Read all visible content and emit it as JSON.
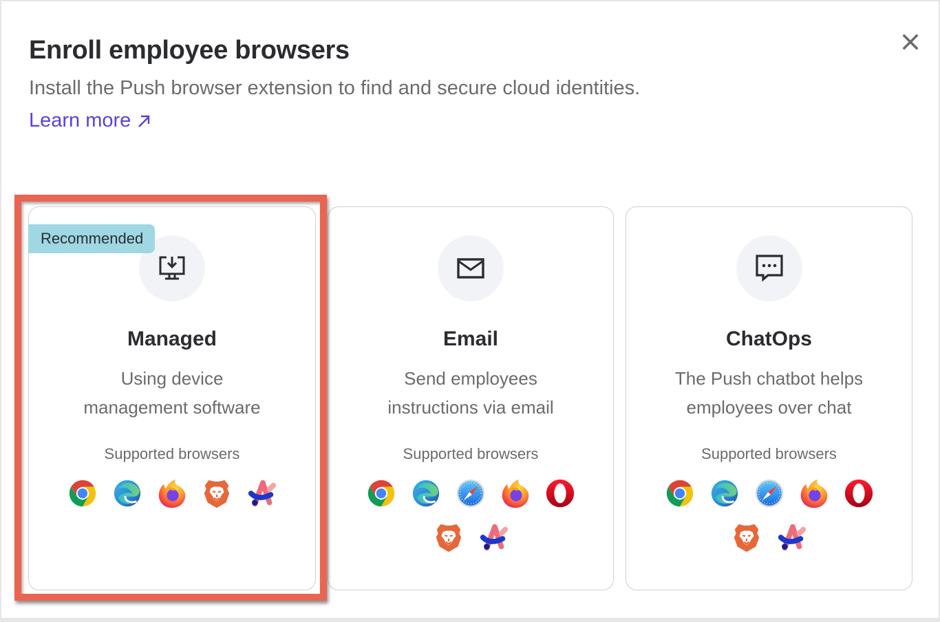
{
  "dialog": {
    "title": "Enroll employee browsers",
    "subtitle": "Install the Push browser extension to find and secure cloud identities.",
    "learn_more_label": "Learn more",
    "close_icon": "close-icon"
  },
  "colors": {
    "accent_link": "#5a43d6",
    "highlight_border": "#ea6452",
    "badge_bg": "#9fd7e3",
    "icon_circle_bg": "#f2f3f7"
  },
  "cards": [
    {
      "id": "managed",
      "badge": "Recommended",
      "icon": "monitor-download-icon",
      "title": "Managed",
      "description_lines": [
        "Using device",
        "management software"
      ],
      "supported_label": "Supported browsers",
      "browsers": [
        "Chrome",
        "Edge",
        "Firefox",
        "Brave",
        "Arc"
      ],
      "highlighted": true
    },
    {
      "id": "email",
      "icon": "envelope-icon",
      "title": "Email",
      "description_lines": [
        "Send employees",
        "instructions via email"
      ],
      "supported_label": "Supported browsers",
      "browsers": [
        "Chrome",
        "Edge",
        "Safari",
        "Firefox",
        "Opera",
        "Brave",
        "Arc"
      ],
      "highlighted": false
    },
    {
      "id": "chatops",
      "icon": "chat-bubble-icon",
      "title": "ChatOps",
      "description_lines": [
        "The Push chatbot helps",
        "employees over chat"
      ],
      "supported_label": "Supported browsers",
      "browsers": [
        "Chrome",
        "Edge",
        "Safari",
        "Firefox",
        "Opera",
        "Brave",
        "Arc"
      ],
      "highlighted": false
    }
  ]
}
